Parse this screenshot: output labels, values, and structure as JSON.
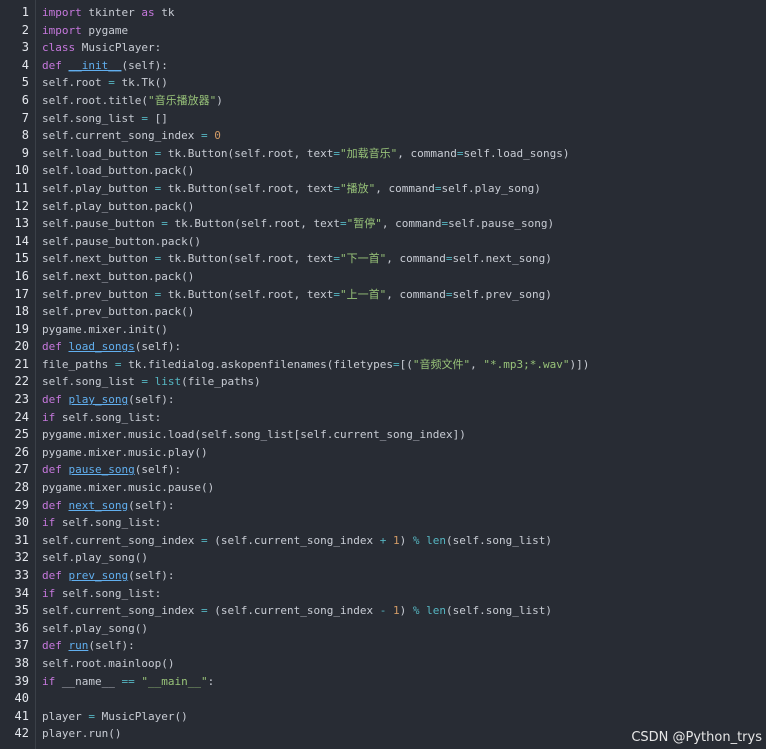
{
  "lines": [
    [
      [
        "k",
        "import"
      ],
      [
        "x",
        " tkinter "
      ],
      [
        "k",
        "as"
      ],
      [
        "x",
        " tk"
      ]
    ],
    [
      [
        "k",
        "import"
      ],
      [
        "x",
        " pygame"
      ]
    ],
    [
      [
        "k",
        "class"
      ],
      [
        "x",
        " MusicPlayer:"
      ]
    ],
    [
      [
        "k",
        "def"
      ],
      [
        "x",
        " "
      ],
      [
        "f",
        "__init__"
      ],
      [
        "x",
        "(self):"
      ]
    ],
    [
      [
        "x",
        "self.root "
      ],
      [
        "o",
        "="
      ],
      [
        "x",
        " tk.Tk()"
      ]
    ],
    [
      [
        "x",
        "self.root.title("
      ],
      [
        "s",
        "\"音乐播放器\""
      ],
      [
        "x",
        ")"
      ]
    ],
    [
      [
        "x",
        "self.song_list "
      ],
      [
        "o",
        "="
      ],
      [
        "x",
        " []"
      ]
    ],
    [
      [
        "x",
        "self.current_song_index "
      ],
      [
        "o",
        "="
      ],
      [
        "x",
        " "
      ],
      [
        "n",
        "0"
      ]
    ],
    [
      [
        "x",
        "self.load_button "
      ],
      [
        "o",
        "="
      ],
      [
        "x",
        " tk.Button(self.root, text"
      ],
      [
        "o",
        "="
      ],
      [
        "s",
        "\"加载音乐\""
      ],
      [
        "x",
        ", command"
      ],
      [
        "o",
        "="
      ],
      [
        "x",
        "self.load_songs)"
      ]
    ],
    [
      [
        "x",
        "self.load_button.pack()"
      ]
    ],
    [
      [
        "x",
        "self.play_button "
      ],
      [
        "o",
        "="
      ],
      [
        "x",
        " tk.Button(self.root, text"
      ],
      [
        "o",
        "="
      ],
      [
        "s",
        "\"播放\""
      ],
      [
        "x",
        ", command"
      ],
      [
        "o",
        "="
      ],
      [
        "x",
        "self.play_song)"
      ]
    ],
    [
      [
        "x",
        "self.play_button.pack()"
      ]
    ],
    [
      [
        "x",
        "self.pause_button "
      ],
      [
        "o",
        "="
      ],
      [
        "x",
        " tk.Button(self.root, text"
      ],
      [
        "o",
        "="
      ],
      [
        "s",
        "\"暂停\""
      ],
      [
        "x",
        ", command"
      ],
      [
        "o",
        "="
      ],
      [
        "x",
        "self.pause_song)"
      ]
    ],
    [
      [
        "x",
        "self.pause_button.pack()"
      ]
    ],
    [
      [
        "x",
        "self.next_button "
      ],
      [
        "o",
        "="
      ],
      [
        "x",
        " tk.Button(self.root, text"
      ],
      [
        "o",
        "="
      ],
      [
        "s",
        "\"下一首\""
      ],
      [
        "x",
        ", command"
      ],
      [
        "o",
        "="
      ],
      [
        "x",
        "self.next_song)"
      ]
    ],
    [
      [
        "x",
        "self.next_button.pack()"
      ]
    ],
    [
      [
        "x",
        "self.prev_button "
      ],
      [
        "o",
        "="
      ],
      [
        "x",
        " tk.Button(self.root, text"
      ],
      [
        "o",
        "="
      ],
      [
        "s",
        "\"上一首\""
      ],
      [
        "x",
        ", command"
      ],
      [
        "o",
        "="
      ],
      [
        "x",
        "self.prev_song)"
      ]
    ],
    [
      [
        "x",
        "self.prev_button.pack()"
      ]
    ],
    [
      [
        "x",
        "pygame.mixer.init()"
      ]
    ],
    [
      [
        "k",
        "def"
      ],
      [
        "x",
        " "
      ],
      [
        "f",
        "load_songs"
      ],
      [
        "x",
        "(self):"
      ]
    ],
    [
      [
        "x",
        "file_paths "
      ],
      [
        "o",
        "="
      ],
      [
        "x",
        " tk.filedialog.askopenfilenames(filetypes"
      ],
      [
        "o",
        "="
      ],
      [
        "x",
        "[("
      ],
      [
        "s",
        "\"音频文件\""
      ],
      [
        "x",
        ", "
      ],
      [
        "s",
        "\"*.mp3;*.wav\""
      ],
      [
        "x",
        ")])"
      ]
    ],
    [
      [
        "x",
        "self.song_list "
      ],
      [
        "o",
        "="
      ],
      [
        "x",
        " "
      ],
      [
        "b",
        "list"
      ],
      [
        "x",
        "(file_paths)"
      ]
    ],
    [
      [
        "k",
        "def"
      ],
      [
        "x",
        " "
      ],
      [
        "f",
        "play_song"
      ],
      [
        "x",
        "(self):"
      ]
    ],
    [
      [
        "k",
        "if"
      ],
      [
        "x",
        " self.song_list:"
      ]
    ],
    [
      [
        "x",
        "pygame.mixer.music.load(self.song_list[self.current_song_index])"
      ]
    ],
    [
      [
        "x",
        "pygame.mixer.music.play()"
      ]
    ],
    [
      [
        "k",
        "def"
      ],
      [
        "x",
        " "
      ],
      [
        "f",
        "pause_song"
      ],
      [
        "x",
        "(self):"
      ]
    ],
    [
      [
        "x",
        "pygame.mixer.music.pause()"
      ]
    ],
    [
      [
        "k",
        "def"
      ],
      [
        "x",
        " "
      ],
      [
        "f",
        "next_song"
      ],
      [
        "x",
        "(self):"
      ]
    ],
    [
      [
        "k",
        "if"
      ],
      [
        "x",
        " self.song_list:"
      ]
    ],
    [
      [
        "x",
        "self.current_song_index "
      ],
      [
        "o",
        "="
      ],
      [
        "x",
        " (self.current_song_index "
      ],
      [
        "o",
        "+"
      ],
      [
        "x",
        " "
      ],
      [
        "n",
        "1"
      ],
      [
        "x",
        ") "
      ],
      [
        "o",
        "%"
      ],
      [
        "x",
        " "
      ],
      [
        "b",
        "len"
      ],
      [
        "x",
        "(self.song_list)"
      ]
    ],
    [
      [
        "x",
        "self.play_song()"
      ]
    ],
    [
      [
        "k",
        "def"
      ],
      [
        "x",
        " "
      ],
      [
        "f",
        "prev_song"
      ],
      [
        "x",
        "(self):"
      ]
    ],
    [
      [
        "k",
        "if"
      ],
      [
        "x",
        " self.song_list:"
      ]
    ],
    [
      [
        "x",
        "self.current_song_index "
      ],
      [
        "o",
        "="
      ],
      [
        "x",
        " (self.current_song_index "
      ],
      [
        "o",
        "-"
      ],
      [
        "x",
        " "
      ],
      [
        "n",
        "1"
      ],
      [
        "x",
        ") "
      ],
      [
        "o",
        "%"
      ],
      [
        "x",
        " "
      ],
      [
        "b",
        "len"
      ],
      [
        "x",
        "(self.song_list)"
      ]
    ],
    [
      [
        "x",
        "self.play_song()"
      ]
    ],
    [
      [
        "k",
        "def"
      ],
      [
        "x",
        " "
      ],
      [
        "f",
        "run"
      ],
      [
        "x",
        "(self):"
      ]
    ],
    [
      [
        "x",
        "self.root.mainloop()"
      ]
    ],
    [
      [
        "k",
        "if"
      ],
      [
        "x",
        " __name__ "
      ],
      [
        "o",
        "=="
      ],
      [
        "x",
        " "
      ],
      [
        "s",
        "\"__main__\""
      ],
      [
        "x",
        ":"
      ]
    ],
    [],
    [
      [
        "x",
        "player "
      ],
      [
        "o",
        "="
      ],
      [
        "x",
        " MusicPlayer()"
      ]
    ],
    [
      [
        "x",
        "player.run()"
      ]
    ]
  ],
  "watermark": "CSDN @Python_trys",
  "colors": {
    "background": "#282c34",
    "keyword": "#c678dd",
    "function": "#61afef",
    "string": "#98c379",
    "number": "#d19a66",
    "operator": "#56b6c2",
    "text": "#c8ccd4"
  }
}
